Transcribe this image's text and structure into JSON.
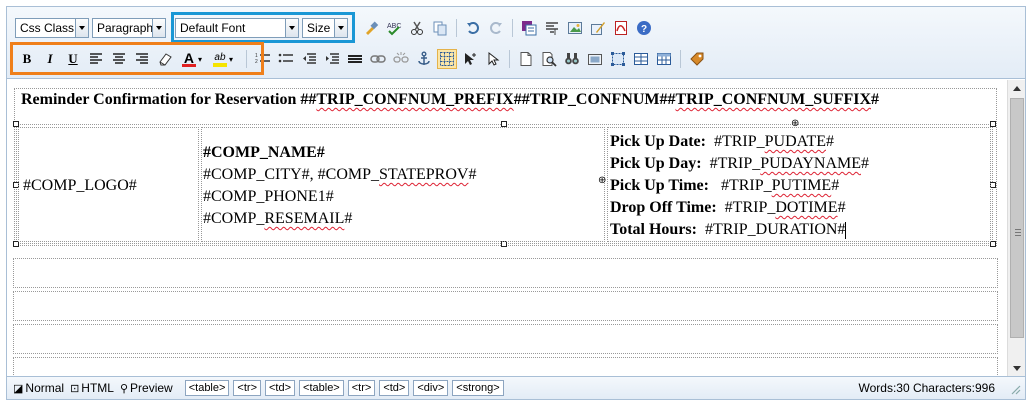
{
  "toolbar": {
    "css_class": "Css Class",
    "paragraph": "Paragraph",
    "font": "Default Font",
    "size": "Size",
    "bold": "B",
    "italic": "I",
    "underline": "U",
    "font_color_glyph": "A",
    "highlight_glyph": "ab"
  },
  "content": {
    "title": {
      "prefix": "Reminder Confirmation for Reservation ##",
      "conf1": "TRIP_CONFNUM_PREFIX",
      "mid1": "##",
      "conf2": "TRIP_CONFNUM",
      "mid2": "##",
      "conf3": "TRIP_CONFNUM_SUFFIX",
      "end": "#"
    },
    "logo": "#COMP_LOGO#",
    "company": {
      "name": "#COMP_NAME#",
      "city_pre": "#COMP_CITY#, #COMP_",
      "city_sq": "STATEPROV",
      "city_post": "#",
      "phone": "#COMP_PHONE1#",
      "email_pre": "#COMP_",
      "email_sq": "RESEMAIL",
      "email_post": "#"
    },
    "trip": [
      {
        "label": "Pick Up Date:",
        "pre": "#TRIP_",
        "sq": "PUDATE",
        "post": "#"
      },
      {
        "label": "Pick Up Day:",
        "pre": "#TRIP_",
        "sq": "PUDAYNAME",
        "post": "#"
      },
      {
        "label": "Pick Up Time:",
        "pre": "#TRIP_",
        "sq": "PUTIME",
        "post": "#"
      },
      {
        "label": "Drop Off Time:",
        "pre": "#TRIP_",
        "sq": "DOTIME",
        "post": "#"
      },
      {
        "label": "Total Hours:",
        "pre": "#TRIP_DURATION#",
        "sq": "",
        "post": ""
      }
    ]
  },
  "status": {
    "normal": "Normal",
    "html": "HTML",
    "preview": "Preview",
    "breadcrumbs": [
      "<table>",
      "<tr>",
      "<td>",
      "<table>",
      "<tr>",
      "<td>",
      "<div>",
      "<strong>"
    ],
    "counts": "Words:30 Characters:996"
  },
  "colors": {
    "highlight_blue": "#1a97d5",
    "highlight_orange": "#ef7f1a"
  }
}
